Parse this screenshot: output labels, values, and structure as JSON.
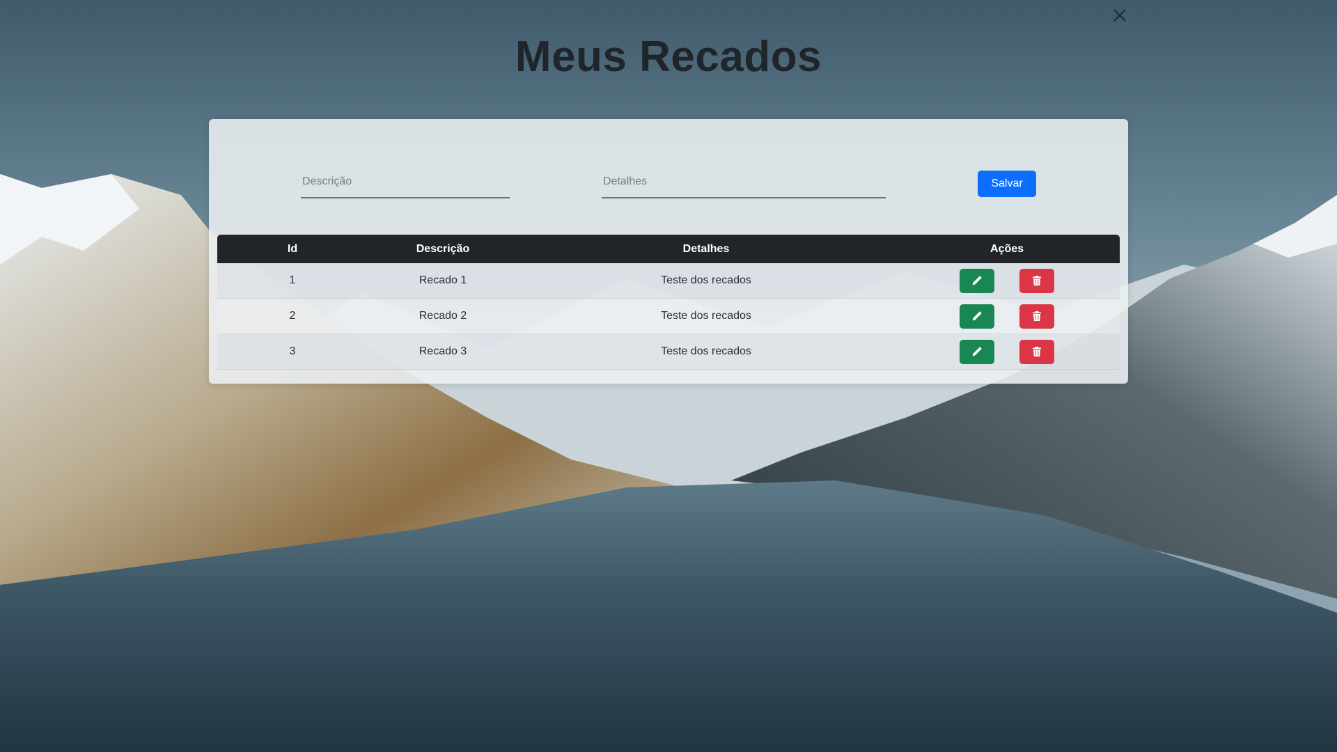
{
  "header": {
    "title": "Meus Recados",
    "close_icon": "close-icon"
  },
  "form": {
    "description_placeholder": "Descrição",
    "details_placeholder": "Detalhes",
    "save_label": "Salvar"
  },
  "table": {
    "headers": {
      "id": "Id",
      "description": "Descrição",
      "details": "Detalhes",
      "actions": "Ações"
    },
    "rows": [
      {
        "id": "1",
        "description": "Recado 1",
        "details": "Teste dos recados"
      },
      {
        "id": "2",
        "description": "Recado 2",
        "details": "Teste dos recados"
      },
      {
        "id": "3",
        "description": "Recado 3",
        "details": "Teste dos recados"
      }
    ],
    "row_actions": {
      "edit_icon": "pencil-icon",
      "delete_icon": "trash-icon"
    }
  },
  "colors": {
    "save_button": "#0d6efd",
    "edit_button": "#198754",
    "delete_button": "#dc3545",
    "table_header": "#212529"
  }
}
